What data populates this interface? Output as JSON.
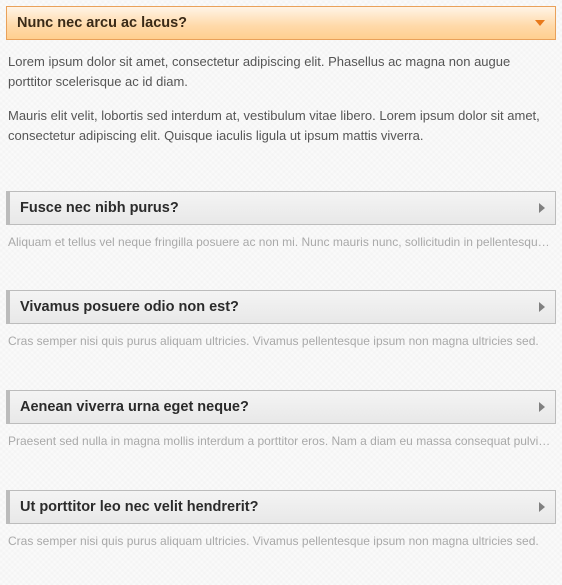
{
  "colors": {
    "active_header_bg_top": "#fff4e6",
    "active_header_bg_bottom": "#ffcf8f",
    "active_header_border": "#e9a15a",
    "active_arrow": "#e8791b",
    "inactive_header_bg_top": "#f4f4f4",
    "inactive_header_bg_bottom": "#e8e8e8",
    "inactive_header_border": "#bcbcbc",
    "inactive_arrow": "#808080",
    "preview_text": "#a9a9a9"
  },
  "accordion": {
    "items": [
      {
        "title": "Nunc nec arcu ac lacus?",
        "expanded": true,
        "body": [
          "Lorem ipsum dolor sit amet, consectetur adipiscing elit. Phasellus ac magna non augue porttitor scelerisque ac id diam.",
          "Mauris elit velit, lobortis sed interdum at, vestibulum vitae libero. Lorem ipsum dolor sit amet, consectetur adipiscing elit. Quisque iaculis ligula ut ipsum mattis viverra."
        ],
        "preview": ""
      },
      {
        "title": "Fusce nec nibh purus?",
        "expanded": false,
        "body": [],
        "preview": "Aliquam et tellus vel neque fringilla posuere ac non mi. Nunc mauris nunc, sollicitudin in pellentesque eget."
      },
      {
        "title": "Vivamus posuere odio non est?",
        "expanded": false,
        "body": [],
        "preview": "Cras semper nisi quis purus aliquam ultricies. Vivamus pellentesque ipsum non magna ultricies sed."
      },
      {
        "title": "Aenean viverra urna eget neque?",
        "expanded": false,
        "body": [],
        "preview": "Praesent sed nulla in magna mollis interdum a porttitor eros. Nam a diam eu massa consequat pulvinar."
      },
      {
        "title": "Ut porttitor leo nec velit hendrerit?",
        "expanded": false,
        "body": [],
        "preview": "Cras semper nisi quis purus aliquam ultricies. Vivamus pellentesque ipsum non magna ultricies sed."
      }
    ]
  }
}
